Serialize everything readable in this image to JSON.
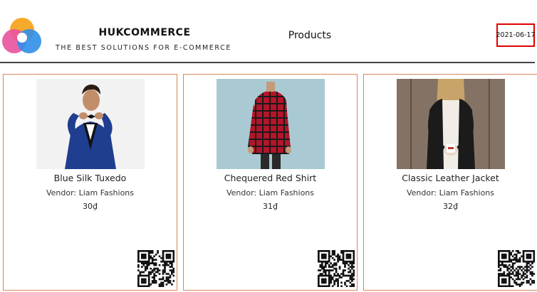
{
  "header": {
    "brand_name": "HUKCOMMERCE",
    "tagline": "THE BEST SOLUTIONS FOR E-COMMERCE",
    "nav_products": "Products",
    "date": "2021-06-17"
  },
  "products": [
    {
      "title": "Blue Silk Tuxedo",
      "vendor": "Vendor: Liam Fashions",
      "price": "30₫"
    },
    {
      "title": "Chequered Red Shirt",
      "vendor": "Vendor: Liam Fashions",
      "price": "31₫"
    },
    {
      "title": "Classic Leather Jacket",
      "vendor": "Vendor: Liam Fashions",
      "price": "32₫"
    }
  ],
  "colors": {
    "card_border": "#d9855a",
    "date_highlight": "#e00000",
    "logo_orange": "#f7a51e",
    "logo_pink": "#e8529e",
    "logo_blue": "#2f8fe8"
  }
}
